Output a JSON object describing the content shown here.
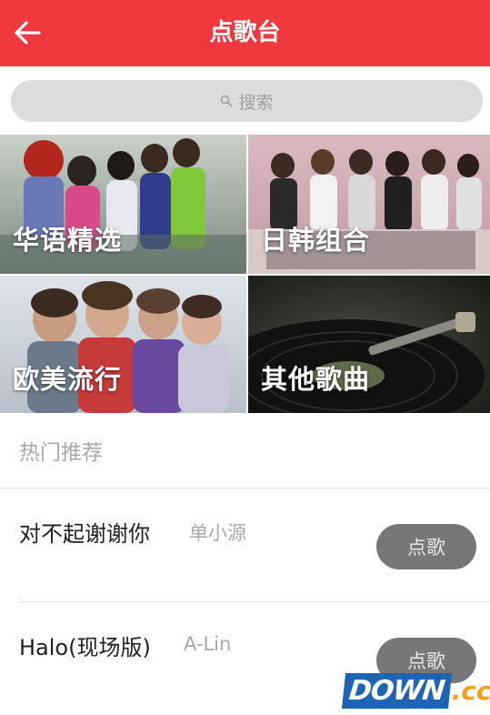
{
  "header": {
    "title": "点歌台",
    "back_icon": "arrow-left-icon",
    "color": "#f0393e"
  },
  "search": {
    "placeholder": "搜索",
    "icon": "search-icon"
  },
  "categories": [
    {
      "label": "华语精选"
    },
    {
      "label": "日韩组合"
    },
    {
      "label": "欧美流行"
    },
    {
      "label": "其他歌曲"
    }
  ],
  "hot": {
    "title": "热门推荐",
    "songs": [
      {
        "title": "对不起谢谢你",
        "artist": "单小源",
        "button": "点歌"
      },
      {
        "title": "Halo(现场版)",
        "artist": "A-Lin",
        "button": "点歌"
      }
    ]
  },
  "watermark": {
    "part1": "DOWN",
    "part2": ".cc"
  }
}
